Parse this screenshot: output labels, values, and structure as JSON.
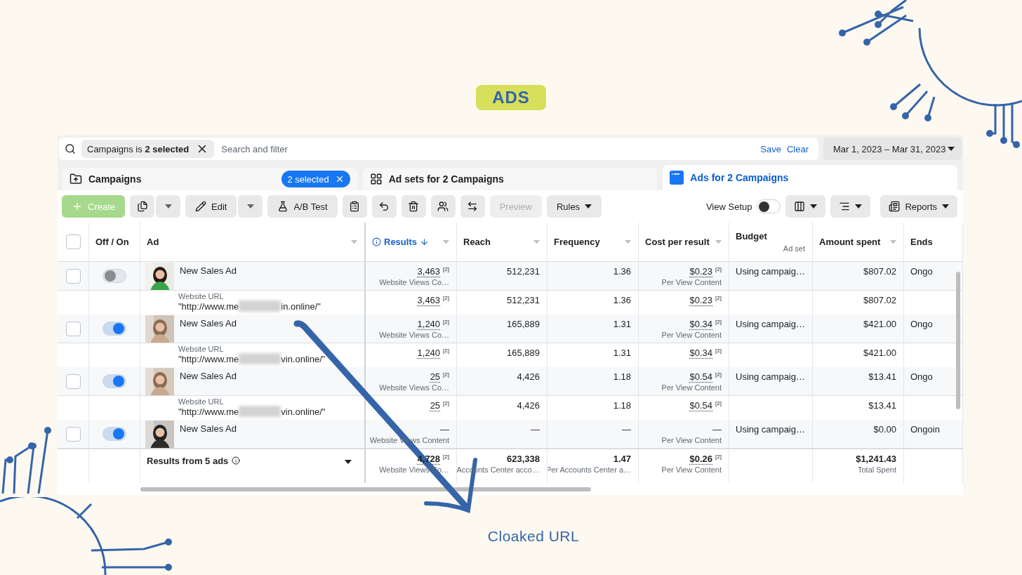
{
  "badge": {
    "label": "ADS"
  },
  "filter_bar": {
    "chip_prefix": "Campaigns is ",
    "chip_bold": "2 selected",
    "placeholder": "Search and filter",
    "save": "Save",
    "clear": "Clear",
    "date_range": "Mar 1, 2023 – Mar 31, 2023"
  },
  "tabs": [
    {
      "kind": "campaigns",
      "label": "Campaigns",
      "chip": "2 selected",
      "selected": false
    },
    {
      "kind": "adsets",
      "label": "Ad sets for 2 Campaigns",
      "selected": false
    },
    {
      "kind": "ads",
      "label": "Ads for 2 Campaigns",
      "selected": true
    }
  ],
  "toolbar": {
    "left": [
      {
        "kind": "create",
        "label": "Create",
        "disabled": true
      },
      {
        "kind": "duplicate",
        "split": true,
        "disabled": false
      },
      {
        "kind": "edit",
        "label": "Edit",
        "split": true,
        "disabled": false
      },
      {
        "kind": "abtest",
        "label": "A/B Test",
        "disabled": false
      },
      {
        "kind": "clipboard",
        "disabled": false
      },
      {
        "kind": "undo",
        "disabled": false
      },
      {
        "kind": "delete",
        "disabled": false
      },
      {
        "kind": "people",
        "disabled": false
      },
      {
        "kind": "swap",
        "disabled": false
      },
      {
        "kind": "preview",
        "label": "Preview",
        "disabled": true
      },
      {
        "kind": "rules",
        "label": "Rules",
        "menu": true,
        "disabled": false
      }
    ],
    "view_setup": {
      "label": "View Setup",
      "on": false
    },
    "right": [
      {
        "kind": "columns",
        "menu": true
      },
      {
        "kind": "breakdown",
        "menu": true
      },
      {
        "kind": "reports",
        "label": "Reports",
        "menu": true
      }
    ]
  },
  "table": {
    "select_all": {
      "checked": false
    },
    "fixed_columns": [
      {
        "label": "Off / On"
      },
      {
        "label": "Ad",
        "menu": true
      }
    ],
    "columns": [
      {
        "label": "Results",
        "menu": true,
        "info": true,
        "sorted": true
      },
      {
        "label": "Reach",
        "menu": true,
        "sorted": false
      },
      {
        "label": "Frequency",
        "menu": true,
        "sorted": false
      },
      {
        "label": "Cost per result",
        "menu": true,
        "sorted": false
      },
      {
        "label": "Budget",
        "sub": "Ad set"
      },
      {
        "label": "Amount spent",
        "menu": true,
        "sorted": false
      },
      {
        "label": "Ends"
      }
    ],
    "rows": [
      {
        "kind": "ad",
        "checked": false,
        "on": false,
        "name": "New Sales Ad",
        "cells": [
          {
            "value": "3,463",
            "note": "[2]",
            "sub": "Website Views Co…"
          },
          {
            "value": "512,231"
          },
          {
            "value": "1.36"
          },
          {
            "value": "$0.23",
            "note": "[2]",
            "sub": "Per View Content"
          },
          {
            "value": "Using campaig…"
          },
          {
            "value": "$807.02"
          },
          {
            "value": "Ongo"
          }
        ]
      },
      {
        "kind": "url",
        "label": "Website URL",
        "url_start": "\"http://www.me",
        "url_end": "in.online/\"",
        "cells": [
          {
            "value": "3,463",
            "note": "[2]"
          },
          {
            "value": "512,231"
          },
          {
            "value": "1.36"
          },
          {
            "value": "$0.23",
            "note": "[2]"
          },
          {},
          {
            "value": "$807.02"
          },
          {}
        ]
      },
      {
        "kind": "ad",
        "checked": false,
        "on": true,
        "name": "New Sales Ad",
        "cells": [
          {
            "value": "1,240",
            "note": "[2]",
            "sub": "Website Views Co…"
          },
          {
            "value": "165,889"
          },
          {
            "value": "1.31"
          },
          {
            "value": "$0.34",
            "note": "[2]",
            "sub": "Per View Content"
          },
          {
            "value": "Using campaig…"
          },
          {
            "value": "$421.00"
          },
          {
            "value": "Ongo"
          }
        ]
      },
      {
        "kind": "url",
        "label": "Website URL",
        "url_start": "\"http://www.me",
        "url_end": "vin.online/\"",
        "cells": [
          {
            "value": "1,240",
            "note": "[2]"
          },
          {
            "value": "165,889"
          },
          {
            "value": "1.31"
          },
          {
            "value": "$0.34",
            "note": "[2]"
          },
          {},
          {
            "value": "$421.00"
          },
          {}
        ]
      },
      {
        "kind": "ad",
        "checked": false,
        "on": true,
        "name": "New Sales Ad",
        "cells": [
          {
            "value": "25",
            "note": "[2]",
            "sub": "Website Views Co…"
          },
          {
            "value": "4,426"
          },
          {
            "value": "1.18"
          },
          {
            "value": "$0.54",
            "note": "[2]",
            "sub": "Per View Content"
          },
          {
            "value": "Using campaig…"
          },
          {
            "value": "$13.41"
          },
          {
            "value": "Ongo"
          }
        ]
      },
      {
        "kind": "url",
        "label": "Website URL",
        "url_start": "\"http://www.me",
        "url_end": "vin.online/\"",
        "cells": [
          {
            "value": "25",
            "note": "[2]"
          },
          {
            "value": "4,426"
          },
          {
            "value": "1.18"
          },
          {
            "value": "$0.54",
            "note": "[2]"
          },
          {},
          {
            "value": "$13.41"
          },
          {}
        ]
      },
      {
        "kind": "ad",
        "checked": false,
        "on": true,
        "name": "New Sales Ad",
        "cells": [
          {
            "value": "—",
            "sub": "Website Views Content"
          },
          {
            "value": "—"
          },
          {
            "value": "—"
          },
          {
            "value": "—",
            "sub": "Per View Content"
          },
          {
            "value": "Using campaig…"
          },
          {
            "value": "$0.00"
          },
          {
            "value": "Ongoin"
          }
        ]
      }
    ],
    "footer": {
      "label": "Results from 5 ads",
      "cells": [
        {
          "value": "4,728",
          "note": "[2]",
          "sub": "Website Views Co…"
        },
        {
          "value": "623,338",
          "sub": "Accounts Center acco…"
        },
        {
          "value": "1.47",
          "sub": "Per Accounts Center a…"
        },
        {
          "value": "$0.26",
          "note": "[2]",
          "sub": "Per View Content"
        },
        {},
        {
          "value": "$1,241.43",
          "sub": "Total Spent"
        },
        {}
      ]
    }
  },
  "caption": "Cloaked URL"
}
